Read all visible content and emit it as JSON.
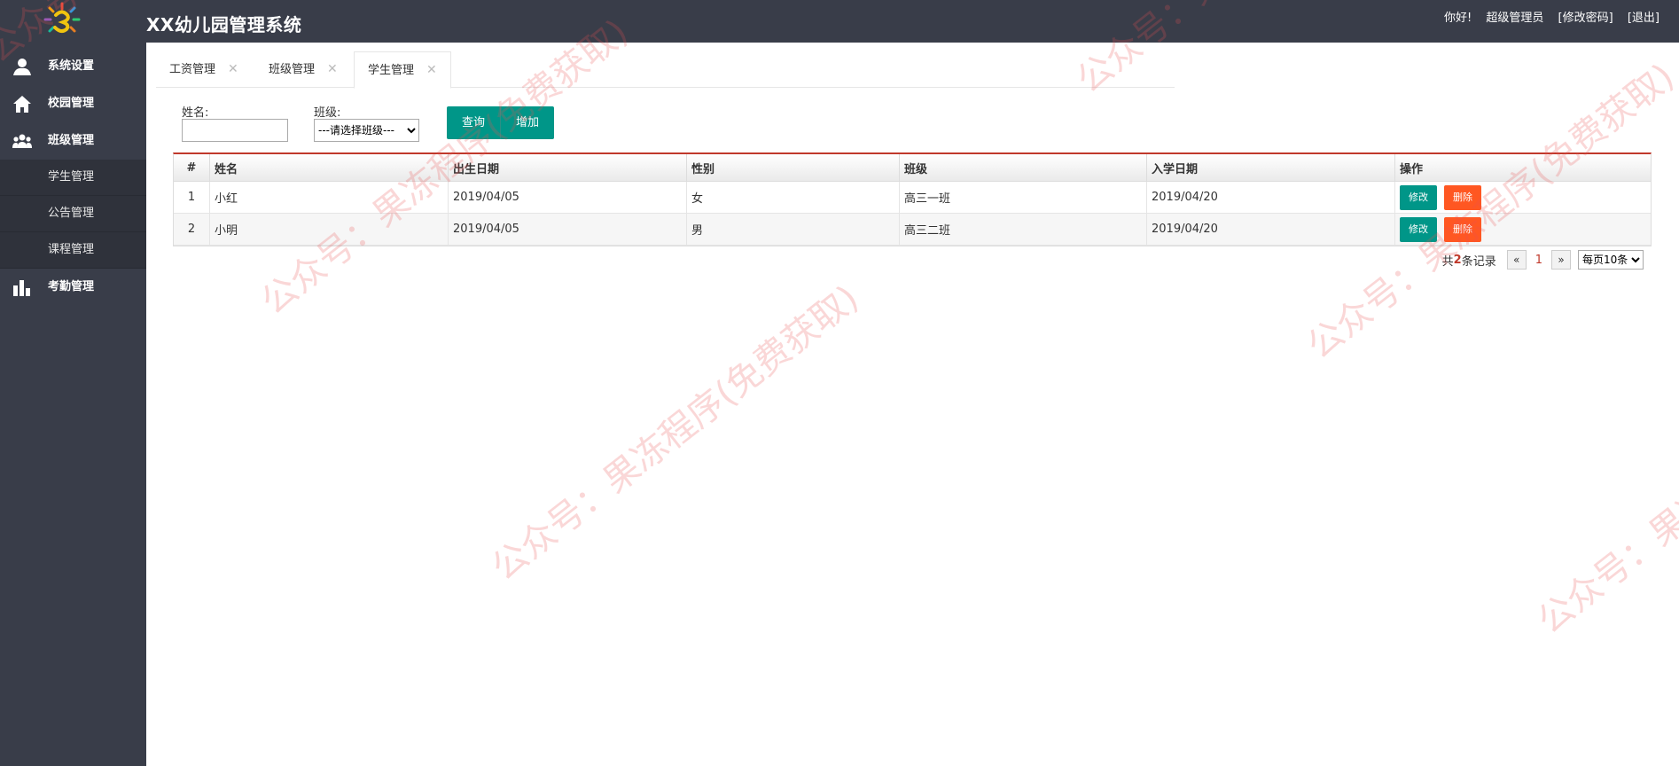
{
  "header": {
    "title": "XX幼儿园管理系统",
    "greeting": "你好!",
    "user": "超级管理员",
    "change_password": "[修改密码]",
    "logout": "[退出]"
  },
  "sidebar": {
    "items": [
      {
        "label": "系统设置",
        "icon": "user-icon"
      },
      {
        "label": "校园管理",
        "icon": "home-icon"
      },
      {
        "label": "班级管理",
        "icon": "group-icon"
      },
      {
        "label": "考勤管理",
        "icon": "bar-chart-icon"
      }
    ],
    "sub_items": [
      "学生管理",
      "公告管理",
      "课程管理"
    ]
  },
  "tabs": [
    {
      "label": "工资管理"
    },
    {
      "label": "班级管理"
    },
    {
      "label": "学生管理",
      "active": true
    }
  ],
  "filters": {
    "name_label": "姓名:",
    "name_value": "",
    "class_label": "班级:",
    "class_selected": "---请选择班级---",
    "query_button": "查询",
    "add_button": "增加"
  },
  "table": {
    "columns": [
      "#",
      "姓名",
      "出生日期",
      "性别",
      "班级",
      "入学日期",
      "操作"
    ],
    "rows": [
      {
        "index": "1",
        "name": "小红",
        "birth": "2019/04/05",
        "gender": "女",
        "class": "高三一班",
        "enroll": "2019/04/20"
      },
      {
        "index": "2",
        "name": "小明",
        "birth": "2019/04/05",
        "gender": "男",
        "class": "高三二班",
        "enroll": "2019/04/20"
      }
    ],
    "edit_label": "修改",
    "delete_label": "删除"
  },
  "pager": {
    "prefix": "共",
    "count": "2",
    "suffix": "条记录",
    "prev": "«",
    "current": "1",
    "next": "»",
    "page_size": "每页10条"
  },
  "watermark": {
    "text": "公众号：果冻程序(免费获取)"
  },
  "colors": {
    "topbar": "#393d49",
    "primary": "#009688",
    "danger": "#ff5722",
    "accent_line": "#c0392b"
  }
}
